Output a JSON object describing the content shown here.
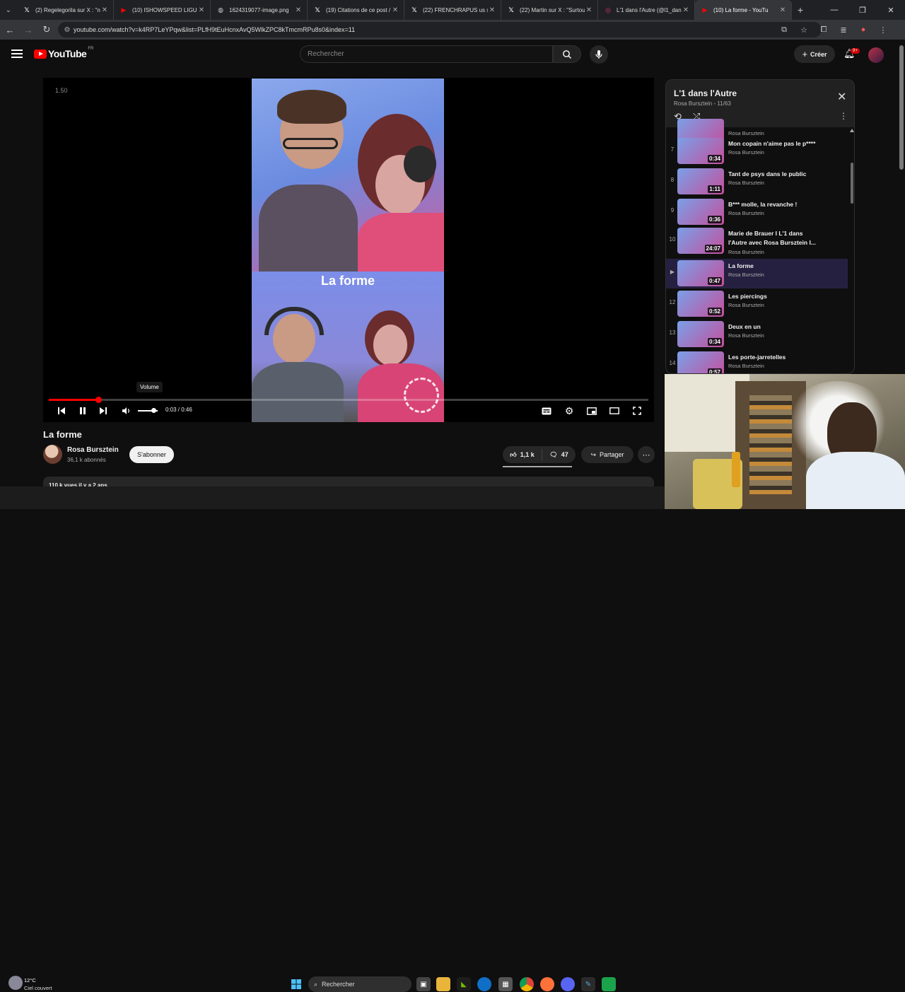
{
  "browser": {
    "tabs": [
      {
        "title": "(2) Regelegorila sur X : \"n",
        "icon": "x-icon",
        "color": "#ffffff"
      },
      {
        "title": "(10) ISHOWSPEED LIGUE",
        "icon": "youtube-icon",
        "color": "#ff0000"
      },
      {
        "title": "1624319077-image.png",
        "icon": "globe-icon",
        "color": "#cccccc"
      },
      {
        "title": "(19) Citations de ce post /",
        "icon": "x-icon",
        "color": "#ffffff"
      },
      {
        "title": "(22) FRENCHRAPUS us su",
        "icon": "x-icon",
        "color": "#ffffff"
      },
      {
        "title": "(22) Martin sur X : \"Surtou",
        "icon": "x-icon",
        "color": "#ffffff"
      },
      {
        "title": "L'1 dans l'Autre (@l1_dan",
        "icon": "instagram-icon",
        "color": "#e1306c"
      },
      {
        "title": "(10) La forme - YouTu",
        "icon": "youtube-icon",
        "color": "#ff0000"
      }
    ],
    "url": "youtube.com/watch?v=k4RP7LeYPqw&list=PLfH9tEuHcnxAvQ5WlkZPC8kTmcmRPu8s0&index=11"
  },
  "header": {
    "logo_text": "YouTube",
    "country": "FR",
    "search_placeholder": "Rechercher",
    "create_label": "Créer",
    "notif_count": "9+"
  },
  "player": {
    "speed_label": "1.50",
    "frame_title": "La forme",
    "tooltip": "Volume",
    "time": "0:03 / 0:46",
    "progress": 0.083,
    "volume": 0.8
  },
  "video": {
    "title": "La forme",
    "channel": "Rosa Bursztein",
    "subscribers": "36,1 k abonnés",
    "subscribe_label": "S'abonner",
    "likes": "1,1 k",
    "comments": "47",
    "share_label": "Partager",
    "description": "110 k vues  il y a 2 ans"
  },
  "playlist": {
    "title": "L'1 dans l'Autre",
    "subtitle": "Rosa Bursztein - 11/63",
    "items": [
      {
        "index": "",
        "title": "",
        "channel": "Rosa Bursztein",
        "duration": ""
      },
      {
        "index": "7",
        "title": "Mon copain n'aime pas le p****",
        "channel": "Rosa Bursztein",
        "duration": "0:34"
      },
      {
        "index": "8",
        "title": "Tant de psys dans le public",
        "channel": "Rosa Bursztein",
        "duration": "1:11"
      },
      {
        "index": "9",
        "title": "B*** molle, la revanche !",
        "channel": "Rosa Bursztein",
        "duration": "0:36"
      },
      {
        "index": "10",
        "title": "Marie de Brauer I L'1 dans l'Autre avec Rosa Bursztein I...",
        "channel": "Rosa Bursztein",
        "duration": "24:07"
      },
      {
        "index": "▶",
        "title": "La forme",
        "channel": "Rosa Bursztein",
        "duration": "0:47",
        "active": true
      },
      {
        "index": "12",
        "title": "Les piercings",
        "channel": "Rosa Bursztein",
        "duration": "0:52"
      },
      {
        "index": "13",
        "title": "Deux en un",
        "channel": "Rosa Bursztein",
        "duration": "0:34"
      },
      {
        "index": "14",
        "title": "Les porte-jarretelles",
        "channel": "Rosa Bursztein",
        "duration": "0:57"
      }
    ]
  },
  "taskbar": {
    "temperature": "12°C",
    "weather": "Ciel couvert",
    "search_label": "Rechercher"
  }
}
